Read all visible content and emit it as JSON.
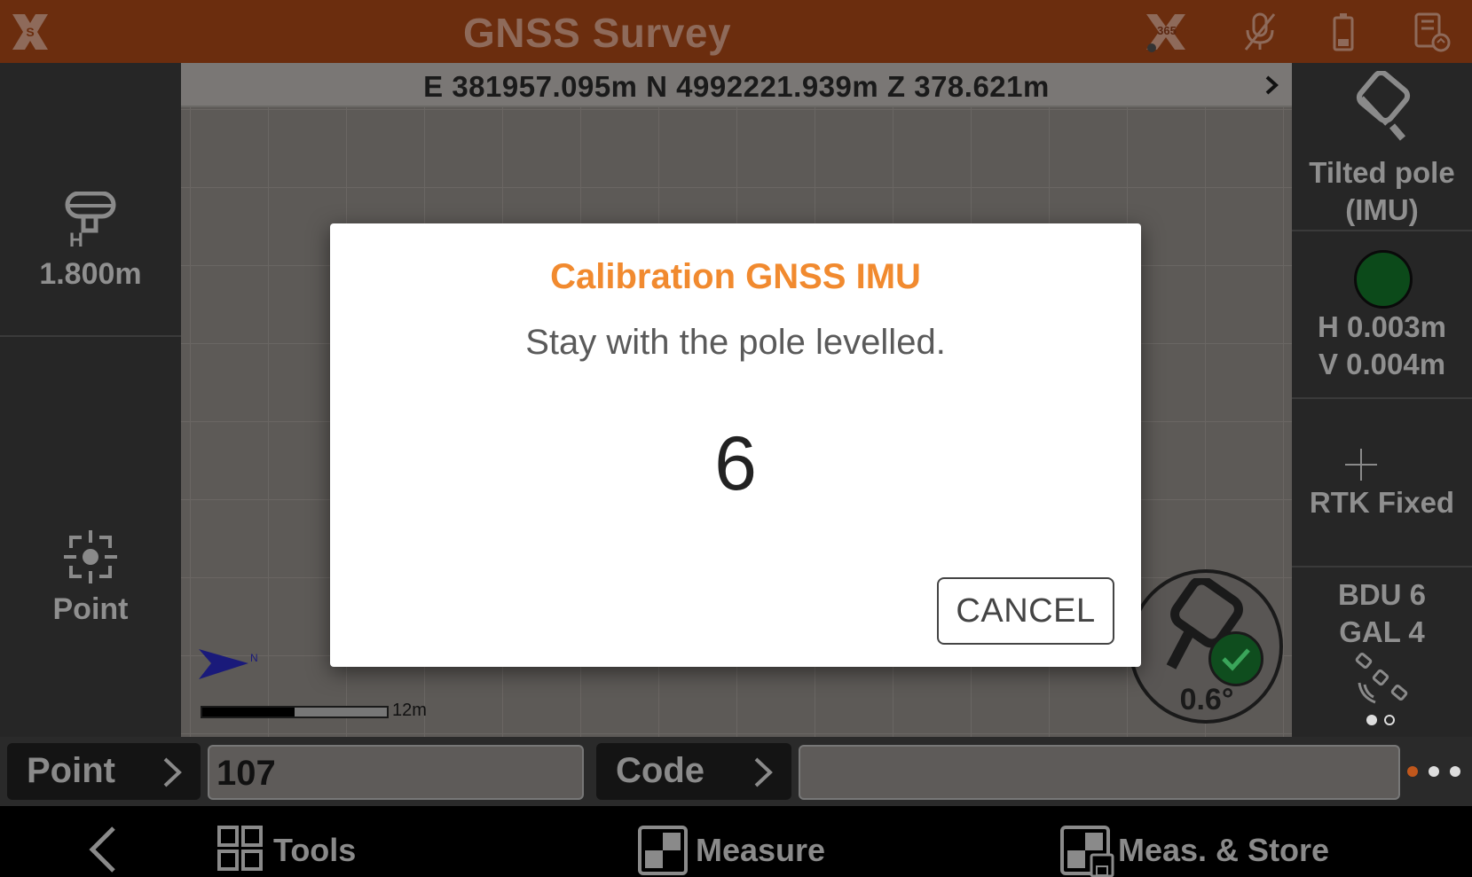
{
  "header": {
    "title": "GNSS Survey",
    "license_badge": "365",
    "icons": [
      "app-logo-icon",
      "license-365-icon",
      "mic-off-icon",
      "battery-icon",
      "device-sync-icon"
    ]
  },
  "left_panel": {
    "antenna_label": "H",
    "pole_height": "1.800m",
    "point_mode_label": "Point"
  },
  "map": {
    "coordinates": "E 381957.095m N 4992221.939m Z 378.621m",
    "north_label": "N",
    "scale_label": "12m",
    "tilt_angle": "0.6°"
  },
  "right_panel": {
    "pole_mode_line1": "Tilted pole",
    "pole_mode_line2": "(IMU)",
    "precision_h": "H 0.003m",
    "precision_v": "V 0.004m",
    "solution": "RTK Fixed",
    "sats_line1": "BDU 6",
    "sats_line2": "GAL 4",
    "status_color": "#0c4a1a"
  },
  "input_row": {
    "point_button": "Point",
    "point_value": "107",
    "code_button": "Code",
    "code_value": ""
  },
  "bottom_nav": {
    "tools": "Tools",
    "measure": "Measure",
    "meas_store": "Meas. & Store"
  },
  "dialog": {
    "title": "Calibration GNSS IMU",
    "message": "Stay with the pole levelled.",
    "countdown": "6",
    "cancel": "CANCEL"
  },
  "colors": {
    "accent": "#f18a2f",
    "header_bg": "#6b2d0e",
    "fix_green": "#0c4a1a"
  }
}
